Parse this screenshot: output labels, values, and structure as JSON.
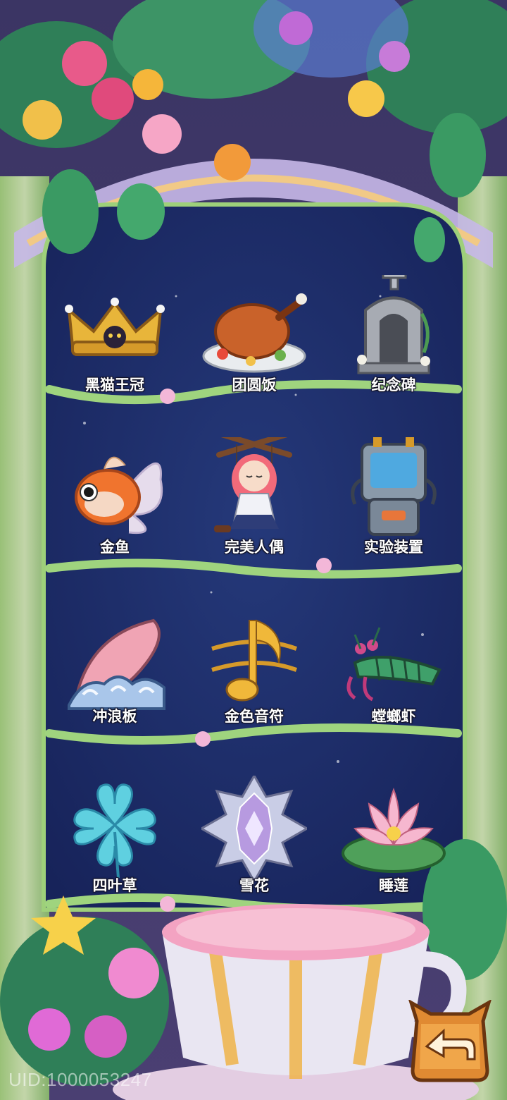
{
  "collection": {
    "items": [
      {
        "label": "黑猫王冠",
        "icon": "crown-icon"
      },
      {
        "label": "团圆饭",
        "icon": "roast-chicken-icon"
      },
      {
        "label": "纪念碑",
        "icon": "monument-icon"
      },
      {
        "label": "金鱼",
        "icon": "goldfish-icon"
      },
      {
        "label": "完美人偶",
        "icon": "puppet-icon"
      },
      {
        "label": "实验装置",
        "icon": "lab-device-icon"
      },
      {
        "label": "冲浪板",
        "icon": "surfboard-icon"
      },
      {
        "label": "金色音符",
        "icon": "music-note-icon"
      },
      {
        "label": "螳螂虾",
        "icon": "mantis-shrimp-icon"
      },
      {
        "label": "四叶草",
        "icon": "clover-icon"
      },
      {
        "label": "雪花",
        "icon": "snowflake-icon"
      },
      {
        "label": "睡莲",
        "icon": "water-lily-icon"
      }
    ]
  },
  "footer": {
    "uid": "UID:1000053247"
  },
  "colors": {
    "panel": "#1f2c63",
    "frame": "#b8e08a",
    "label": "#ffffff"
  }
}
